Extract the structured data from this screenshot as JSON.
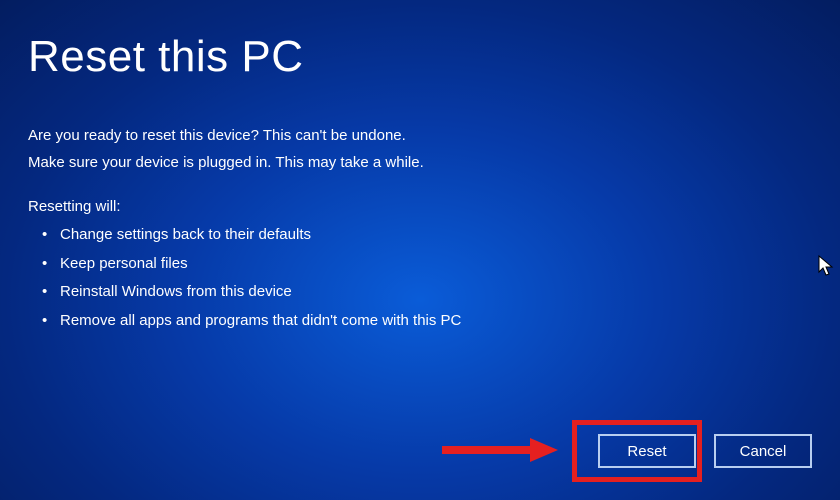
{
  "title": "Reset this PC",
  "intro": {
    "line1": "Are you ready to reset this device? This can't be undone.",
    "line2": "Make sure your device is plugged in. This may take a while."
  },
  "subheading": "Resetting will:",
  "bullets": {
    "item0": "Change settings back to their defaults",
    "item1": "Keep personal files",
    "item2": "Reinstall Windows from this device",
    "item3": "Remove all apps and programs that didn't come with this PC"
  },
  "buttons": {
    "reset": "Reset",
    "cancel": "Cancel"
  }
}
